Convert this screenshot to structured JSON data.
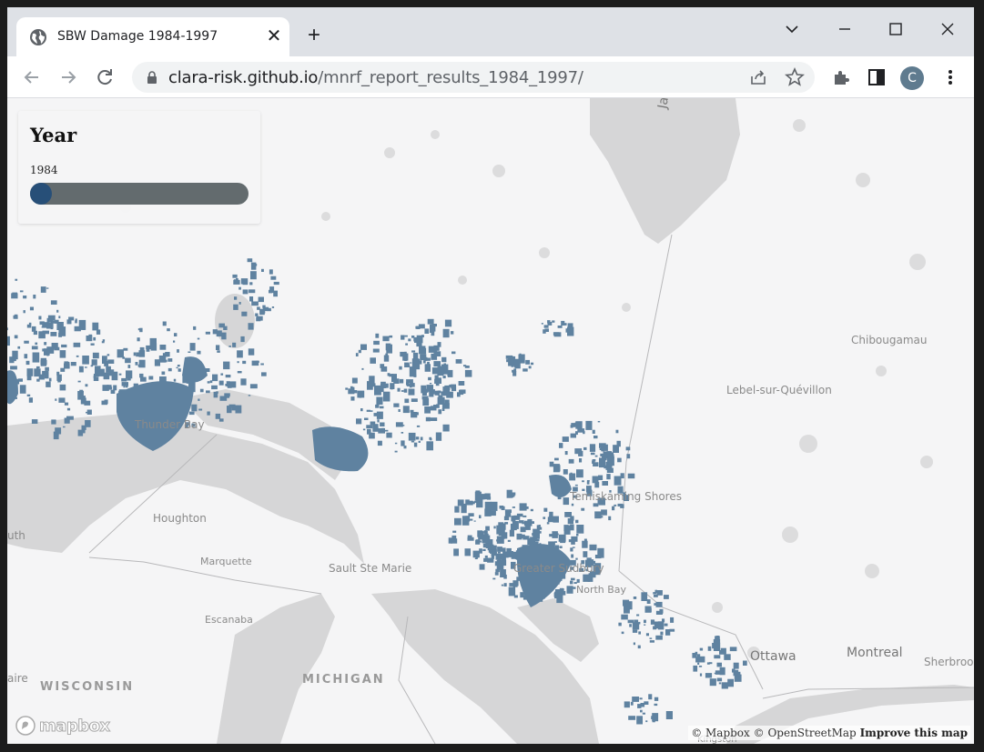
{
  "browser": {
    "tab_title": "SBW Damage 1984-1997",
    "url_host": "clara-risk.github.io",
    "url_path": "/mnrf_report_results_1984_1997/",
    "profile_initial": "C"
  },
  "panel": {
    "title": "Year",
    "value": "1984",
    "slider_min": 1984,
    "slider_max": 1997,
    "slider_value": 1984
  },
  "map": {
    "labels": [
      {
        "name": "map-label-thunder-bay",
        "text": "Thunder Bay"
      },
      {
        "name": "map-label-houghton",
        "text": "Houghton"
      },
      {
        "name": "map-label-marquette",
        "text": "Marquette"
      },
      {
        "name": "map-label-sault-ste-marie",
        "text": "Sault Ste Marie"
      },
      {
        "name": "map-label-escanaba",
        "text": "Escanaba"
      },
      {
        "name": "map-label-temiskaming-shores",
        "text": "Temiskaming Shores"
      },
      {
        "name": "map-label-greater-sudbury",
        "text": "Greater Sudbury"
      },
      {
        "name": "map-label-north-bay",
        "text": "North Bay"
      },
      {
        "name": "map-label-lebel-sur-quevillon",
        "text": "Lebel-sur-Quévillon"
      },
      {
        "name": "map-label-chibougamau",
        "text": "Chibougamau"
      },
      {
        "name": "map-label-ottawa",
        "text": "Ottawa"
      },
      {
        "name": "map-label-montreal",
        "text": "Montreal"
      },
      {
        "name": "map-label-sherbrooke",
        "text": "Sherbroo"
      },
      {
        "name": "map-label-wisconsin",
        "text": "WISCONSIN"
      },
      {
        "name": "map-label-michigan",
        "text": "MICHIGAN"
      },
      {
        "name": "map-label-duluth",
        "text": "uth"
      },
      {
        "name": "map-label-claire",
        "text": "aire"
      },
      {
        "name": "map-label-kingston",
        "text": "Kingston"
      },
      {
        "name": "map-label-james-bay",
        "text": "Jar"
      }
    ],
    "damage_color": "#5f82a0",
    "water_color": "#d6d6d7",
    "land_color": "#f5f5f6"
  },
  "attribution": {
    "mapbox": "© Mapbox",
    "osm": "© OpenStreetMap",
    "improve": "Improve this map",
    "logo_text": "mapbox"
  }
}
